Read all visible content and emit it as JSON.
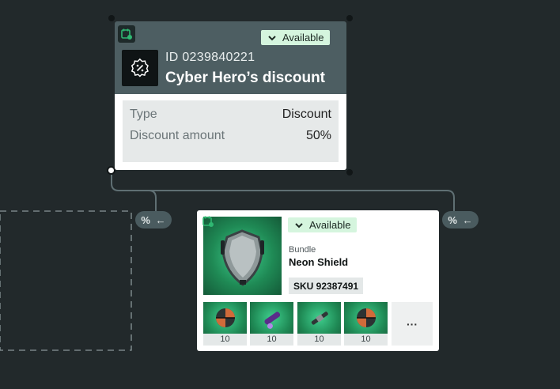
{
  "discount_card": {
    "status": "Available",
    "id": "ID 0239840221",
    "title": "Cyber Hero’s discount",
    "rows": [
      {
        "label": "Type",
        "value": "Discount"
      },
      {
        "label": "Discount amount",
        "value": "50%"
      }
    ]
  },
  "connectors": {
    "pill_symbol": "%",
    "pill_arrow": "←"
  },
  "bundle_card": {
    "status": "Available",
    "kind": "Bundle",
    "name": "Neon Shield",
    "sku": "SKU 92387491",
    "items": [
      {
        "count": "10",
        "icon": "orb-icon"
      },
      {
        "count": "10",
        "icon": "flashlight-icon"
      },
      {
        "count": "10",
        "icon": "blaster-icon"
      },
      {
        "count": "10",
        "icon": "orb-icon"
      }
    ],
    "more_label": "···"
  },
  "colors": {
    "background": "#22292b",
    "header": "#4d5e62",
    "accent_green": "#2fb872",
    "badge_bg": "#d5f5de"
  }
}
